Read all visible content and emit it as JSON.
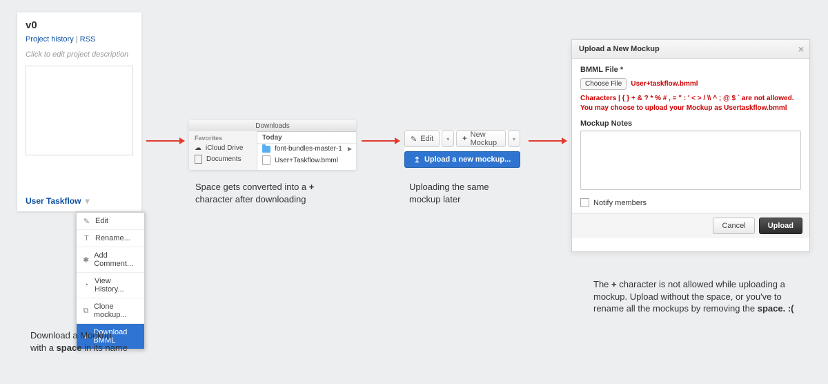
{
  "project": {
    "title": "v0",
    "link_history": "Project history",
    "link_rss": "RSS",
    "description_placeholder": "Click to edit project description",
    "mockup_title": "User Taskflow"
  },
  "menu": {
    "items": [
      "Edit",
      "Rename...",
      "Add Comment...",
      "View History...",
      "Clone mockup...",
      "Download BMML"
    ]
  },
  "caption1_a": "Download a Mockup",
  "caption1_b": "with a ",
  "caption1_c": "space",
  "caption1_d": " in its name",
  "finder": {
    "title": "Downloads",
    "sidebar_header": "Favorites",
    "sidebar_items": [
      "iCloud Drive",
      "Documents"
    ],
    "main_header": "Today",
    "rows": [
      "font-bundles-master-1",
      "User+Taskflow.bmml"
    ]
  },
  "caption2_a": "Space gets converted into a ",
  "caption2_b": "+",
  "caption2_c": " character after downloading",
  "toolbar": {
    "edit": "Edit",
    "new": "New Mockup",
    "upload": "Upload a new mockup..."
  },
  "caption3": "Uploading the same mockup later",
  "dialog": {
    "title": "Upload a New Mockup",
    "file_label": "BMML File *",
    "choose": "Choose File",
    "filename": "User+taskflow.bmml",
    "error": "Characters | { } + & ? * % # , = \" : ' < > / \\\\ ^ ; @ $ ` are not allowed. You may choose to upload your Mockup as Usertaskflow.bmml",
    "notes_label": "Mockup Notes",
    "notify": "Notify members",
    "cancel": "Cancel",
    "upload": "Upload"
  },
  "caption4_a": "The ",
  "caption4_b": "+",
  "caption4_c": " character is not allowed while uploading a mockup. Upload without the space, or you've to rename all the mockups by removing the ",
  "caption4_d": "space. :("
}
